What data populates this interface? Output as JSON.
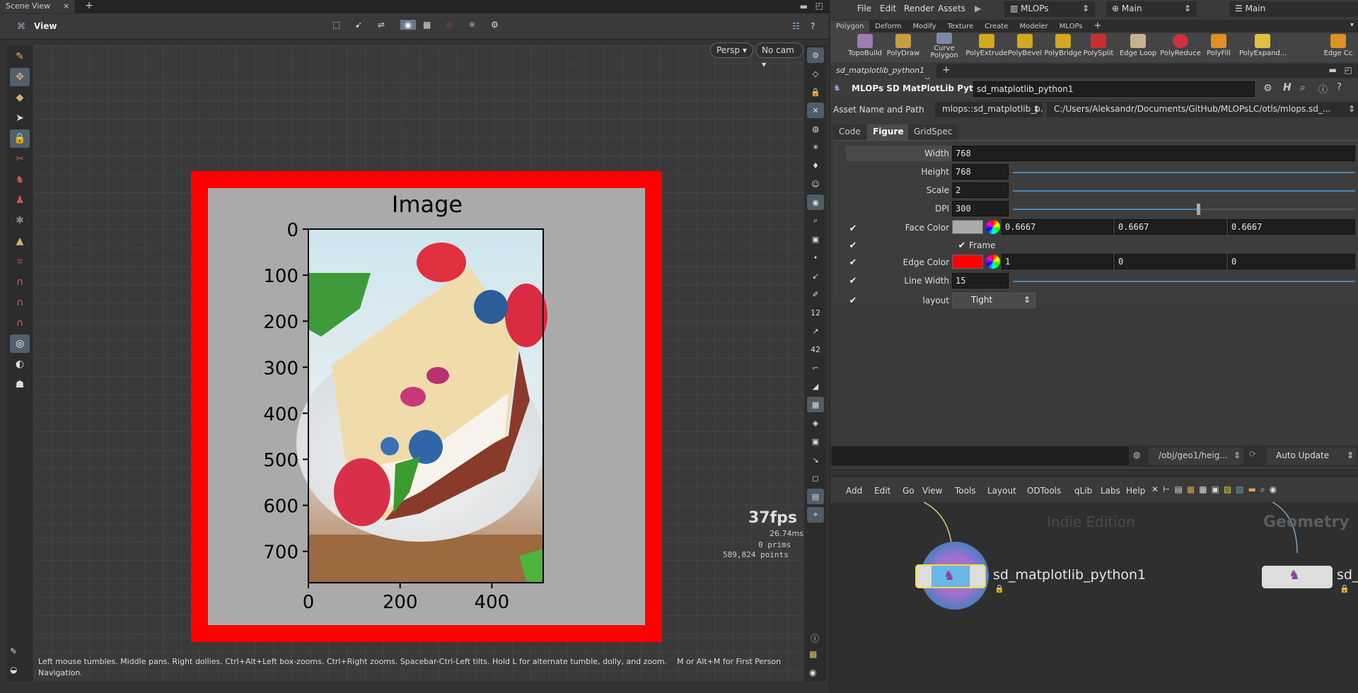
{
  "scene_tab": {
    "label": "Scene View",
    "close": "×",
    "add": "+"
  },
  "viewbar": {
    "view_label": "View"
  },
  "viewport": {
    "persp": "Persp",
    "cam": "No cam",
    "fps": "37fps",
    "ms": "26.74ms",
    "prims": "0  prims",
    "points": "589,824 points",
    "help_line1": "Left mouse tumbles. Middle pans. Right dollies. Ctrl+Alt+Left box-zooms. Ctrl+Right zooms. Spacebar-Ctrl-Left tilts. Hold L for alternate tumble, dolly, and zoom.",
    "help_extra": "M or Alt+M for First Person",
    "help_line2": "Navigation."
  },
  "chart_data": {
    "type": "image",
    "title": "Image",
    "yticks": [
      "0",
      "100",
      "200",
      "300",
      "400",
      "500",
      "600",
      "700"
    ],
    "xticks": [
      "0",
      "200",
      "400"
    ],
    "face_color": "#aaaaaa",
    "edge_color": "#ff0000"
  },
  "menubar": {
    "file": "File",
    "edit": "Edit",
    "render": "Render",
    "assets": "Assets",
    "desktop": "MLOPs",
    "context": "Main",
    "right": "Main"
  },
  "shelf_tabs": [
    "Polygon",
    "Deform",
    "Modify",
    "Texture",
    "Create",
    "Modeler",
    "MLOPs"
  ],
  "shelf_tools": [
    "TopoBuild",
    "PolyDraw",
    "Curve Polygon",
    "PolyExtrude",
    "PolyBevel",
    "PolyBridge",
    "PolySplit",
    "Edge Loop",
    "PolyReduce",
    "PolyFill",
    "PolyExpand...",
    "Edge Cc"
  ],
  "param_tab": {
    "label": "sd_matplotlib_python1"
  },
  "node_header": {
    "type": "MLOPs SD MatPlotLib Python",
    "name": "sd_matplotlib_python1"
  },
  "asset": {
    "label": "Asset Name and Path",
    "name": "mlops::sd_matplotlib_p...",
    "path": "C:/Users/Aleksandr/Documents/GitHub/MLOPsLC/otls/mlops.sd_..."
  },
  "sub_tabs": [
    "Code",
    "Figure",
    "GridSpec"
  ],
  "params": {
    "width_label": "Width",
    "width": "768",
    "height_label": "Height",
    "height": "768",
    "scale_label": "Scale",
    "scale": "2",
    "dpi_label": "DPI",
    "dpi": "300",
    "face_label": "Face Color",
    "face_r": "0.6667",
    "face_g": "0.6667",
    "face_b": "0.6667",
    "frame_label": "Frame",
    "edge_label": "Edge Color",
    "edge_r": "1",
    "edge_g": "0",
    "edge_b": "0",
    "linewidth_label": "Line Width",
    "linewidth": "15",
    "layout_label": "layout",
    "layout": "Tight"
  },
  "status": {
    "path": "/obj/geo1/heig...",
    "update": "Auto Update"
  },
  "net_menu": [
    "Add",
    "Edit",
    "Go",
    "View",
    "Tools",
    "Layout",
    "ODTools",
    "qLib",
    "Labs",
    "Help"
  ],
  "network": {
    "watermark": "Indie Edition",
    "context": "Geometry",
    "node1": "sd_matplotlib_python1",
    "node2": "sd_"
  }
}
